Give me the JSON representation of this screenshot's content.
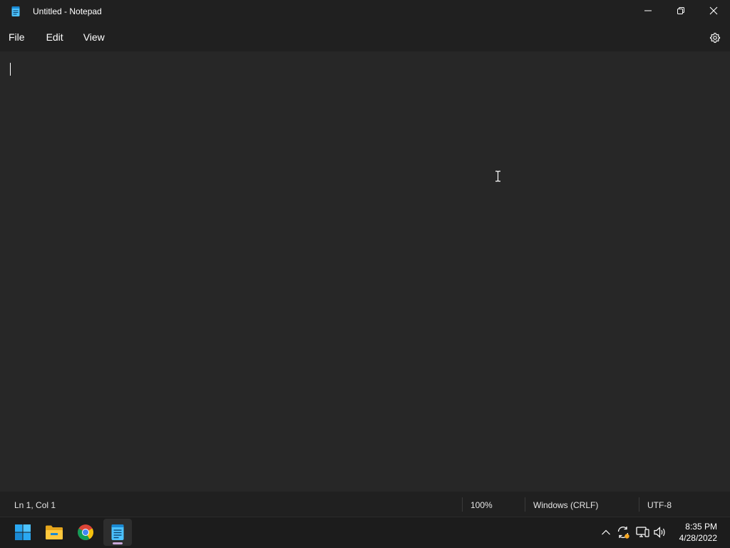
{
  "window": {
    "title": "Untitled - Notepad",
    "controls": [
      "minimize-icon",
      "restore-icon",
      "close-icon"
    ]
  },
  "menu": {
    "items": [
      {
        "label": "File"
      },
      {
        "label": "Edit"
      },
      {
        "label": "View"
      }
    ],
    "settings_icon": "gear-icon"
  },
  "editor": {
    "content": ""
  },
  "status": {
    "position": "Ln 1, Col 1",
    "zoom": "100%",
    "line_ending": "Windows (CRLF)",
    "encoding": "UTF-8"
  },
  "taskbar": {
    "apps": [
      "windows-start-icon",
      "file-explorer-icon",
      "chrome-icon",
      "notepad-icon"
    ],
    "active_app": "notepad-icon",
    "tray": [
      "chevron-up-icon",
      "sync-icon",
      "network-icon",
      "volume-icon"
    ],
    "time": "8:35 PM",
    "date": "4/28/2022"
  },
  "colors": {
    "background": "#272727",
    "chrome": "#202020",
    "taskbar": "#1c1c1c",
    "notepad_blue": "#4cc2ff",
    "active_indicator": "#c9a7d9"
  }
}
